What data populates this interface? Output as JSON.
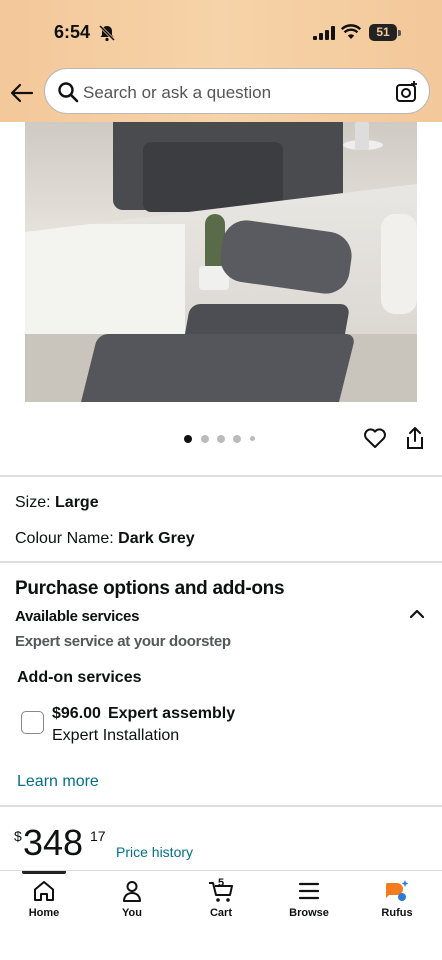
{
  "status_bar": {
    "time": "6:54",
    "battery": "51"
  },
  "header": {
    "search_placeholder": "Search or ask a question"
  },
  "gallery": {
    "image_count": 5,
    "active_index": 0
  },
  "attributes": {
    "size_label": "Size:",
    "size_value": "Large",
    "colour_label": "Colour Name:",
    "colour_value": "Dark Grey"
  },
  "purchase_options": {
    "title": "Purchase options and add-ons",
    "available_services": "Available services",
    "expert_service": "Expert service at your doorstep",
    "addon_title": "Add-on services",
    "option_price": "$96.00",
    "option_name": "Expert assembly",
    "option_sub": "Expert Installation",
    "option_checked": false,
    "learn_more": "Learn more"
  },
  "price": {
    "currency": "$",
    "whole": "348",
    "fraction": "17",
    "history_link": "Price history"
  },
  "bottom_nav": {
    "items": [
      {
        "label": "Home",
        "icon": "home-icon"
      },
      {
        "label": "You",
        "icon": "person-icon"
      },
      {
        "label": "Cart",
        "icon": "cart-icon",
        "count": "5"
      },
      {
        "label": "Browse",
        "icon": "menu-icon"
      },
      {
        "label": "Rufus",
        "icon": "rufus-icon"
      }
    ]
  },
  "colors": {
    "header_bg": "#f3c89a",
    "link": "#007185",
    "text": "#0f1111"
  }
}
